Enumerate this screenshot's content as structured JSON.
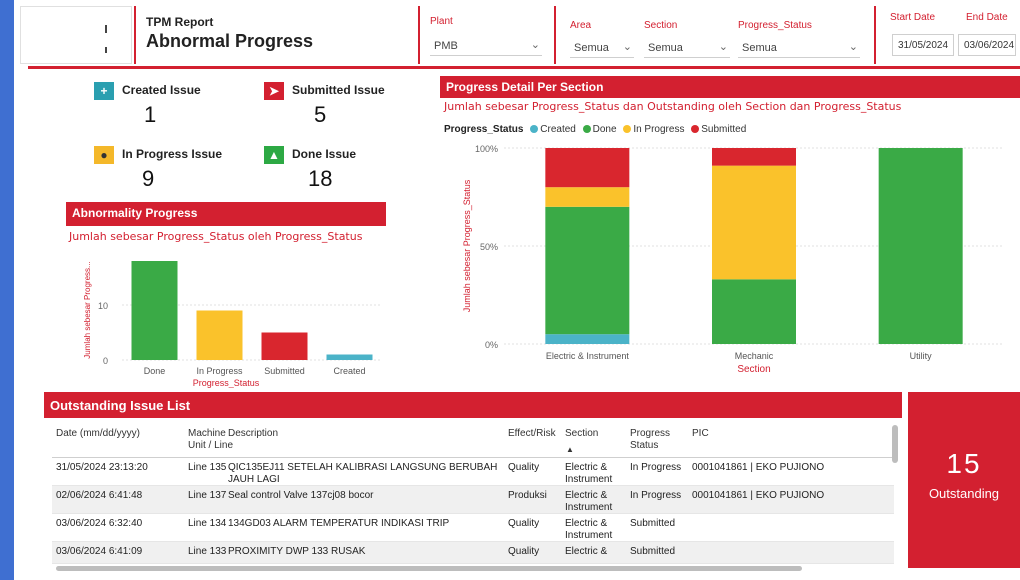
{
  "header": {
    "report_label": "TPM Report",
    "title": "Abnormal Progress",
    "plant": {
      "label": "Plant",
      "value": "PMB"
    },
    "area": {
      "label": "Area",
      "value": "Semua"
    },
    "section": {
      "label": "Section",
      "value": "Semua"
    },
    "progress_status": {
      "label": "Progress_Status",
      "value": "Semua"
    },
    "start_date": {
      "label": "Start Date",
      "value": "31/05/2024"
    },
    "end_date": {
      "label": "End Date",
      "value": "03/06/2024"
    }
  },
  "kpis": [
    {
      "label": "Created Issue",
      "value": "1",
      "icon": "plus-icon",
      "color": "#2a9fb0"
    },
    {
      "label": "Submitted Issue",
      "value": "5",
      "icon": "send-icon",
      "color": "#d32030"
    },
    {
      "label": "In Progress Issue",
      "value": "9",
      "icon": "clock-icon",
      "color": "#f4b82a"
    },
    {
      "label": "Done Issue",
      "value": "18",
      "icon": "thumbs-up-icon",
      "color": "#2da944"
    }
  ],
  "colors": {
    "created": "#4bb3c8",
    "done": "#3aaa46",
    "in_progress": "#fac22b",
    "submitted": "#d9262e",
    "accent": "#d32030"
  },
  "abnormality": {
    "title": "Abnormality Progress",
    "subtitle": "Jumlah sebesar Progress_Status oleh Progress_Status",
    "ylabel": "Jumlah sebesar Progress...",
    "xlabel": "Progress_Status"
  },
  "detail": {
    "title": "Progress Detail Per Section",
    "subtitle": "Jumlah sebesar Progress_Status dan Outstanding oleh Section dan Progress_Status",
    "legend_title": "Progress_Status",
    "legend": [
      "Created",
      "Done",
      "In Progress",
      "Submitted"
    ],
    "ylabel": "Jumlah sebesar Progress_Status",
    "xlabel": "Section"
  },
  "chart_data": [
    {
      "type": "bar",
      "title": "Abnormality Progress",
      "categories": [
        "Done",
        "In Progress",
        "Submitted",
        "Created"
      ],
      "values": [
        18,
        9,
        5,
        1
      ],
      "yticks": [
        0,
        10
      ],
      "ylim": [
        0,
        20
      ],
      "xlabel": "Progress_Status",
      "ylabel": "Jumlah sebesar Progress..."
    },
    {
      "type": "bar",
      "stacked": "percent",
      "title": "Progress Detail Per Section",
      "categories": [
        "Electric & Instrument",
        "Mechanic",
        "Utility"
      ],
      "series": [
        {
          "name": "Created",
          "values": [
            5,
            0,
            0
          ]
        },
        {
          "name": "Done",
          "values": [
            65,
            33,
            100
          ]
        },
        {
          "name": "In Progress",
          "values": [
            10,
            58,
            0
          ]
        },
        {
          "name": "Submitted",
          "values": [
            20,
            9,
            0
          ]
        }
      ],
      "yticks": [
        "0%",
        "50%",
        "100%"
      ],
      "xlabel": "Section",
      "ylabel": "Jumlah sebesar Progress_Status"
    }
  ],
  "issues": {
    "title": "Outstanding Issue List",
    "columns": [
      "Date (mm/dd/yyyy)",
      "Machine Unit / Line",
      "Description",
      "Effect/Risk",
      "Section",
      "Progress Status",
      "PIC"
    ],
    "rows": [
      [
        "31/05/2024 23:13:20",
        "Line 135",
        "QIC135EJ11 SETELAH KALIBRASI LANGSUNG BERUBAH JAUH LAGI",
        "Quality",
        "Electric & Instrument",
        "In Progress",
        "0001041861 | EKO PUJIONO"
      ],
      [
        "02/06/2024 6:41:48",
        "Line 137",
        "Seal control Valve 137cj08 bocor",
        "Produksi",
        "Electric & Instrument",
        "In Progress",
        "0001041861 | EKO PUJIONO"
      ],
      [
        "03/06/2024 6:32:40",
        "Line 134",
        "134GD03 ALARM TEMPERATUR INDIKASI TRIP",
        "Quality",
        "Electric & Instrument",
        "Submitted",
        ""
      ],
      [
        "03/06/2024 6:41:09",
        "Line 133",
        "PROXIMITY DWP 133 RUSAK",
        "Quality",
        "Electric &",
        "Submitted",
        ""
      ]
    ]
  },
  "outstanding": {
    "value": "15",
    "label": "Outstanding"
  }
}
